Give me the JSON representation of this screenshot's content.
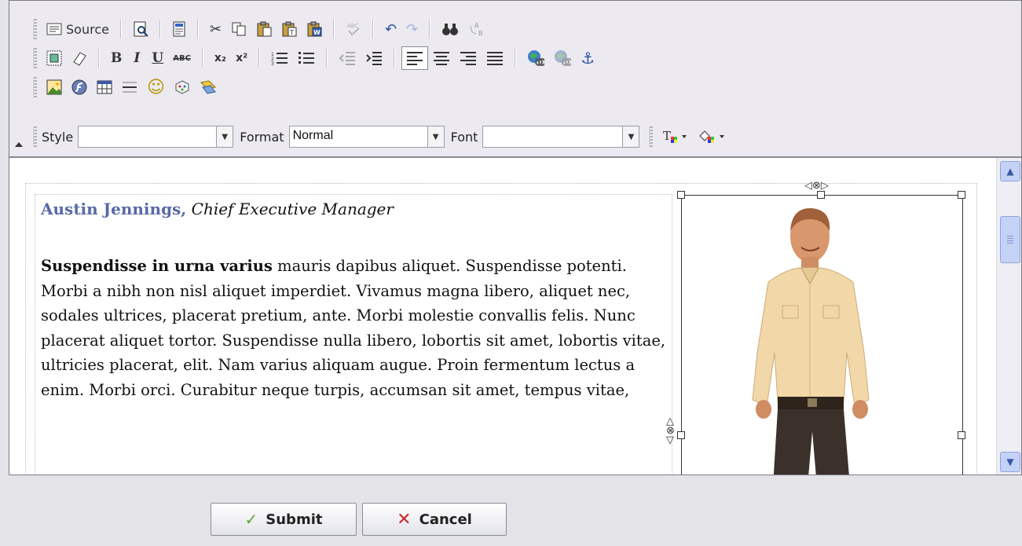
{
  "toolbar": {
    "row1": {
      "source_label": "Source",
      "icons": [
        "source-icon",
        "preview-icon",
        "templates-icon",
        "cut-icon",
        "copy-icon",
        "paste-icon",
        "paste-text-icon",
        "paste-word-icon",
        "spellcheck-icon",
        "undo-icon",
        "redo-icon",
        "find-icon",
        "replace-icon"
      ]
    },
    "row2": {
      "bold": "B",
      "italic": "I",
      "underline": "U",
      "strike": "ABC",
      "subscript": "x₂",
      "superscript": "x²"
    },
    "row4": {
      "style_label": "Style",
      "style_value": "",
      "format_label": "Format",
      "format_value": "Normal",
      "font_label": "Font",
      "font_value": ""
    }
  },
  "content": {
    "author_name": "Austin Jennings,",
    "author_title": "Chief Executive Manager",
    "body_lead": "Suspendisse in urna varius",
    "body_text": "mauris dapibus aliquet. Suspendisse potenti. Morbi a nibh non nisl aliquet imperdiet. Vivamus magna libero, aliquet nec, sodales ultrices, placerat pretium, ante. Morbi molestie convallis felis. Nunc placerat aliquet tortor. Suspendisse nulla libero, lobortis sit amet, lobortis vitae, ultricies placerat, elit. Nam varius aliquam augue. Proin fermentum lectus a enim. Morbi orci. Curabitur neque turpis, accumsan sit amet, tempus vitae,"
  },
  "buttons": {
    "submit_label": "Submit",
    "cancel_label": "Cancel"
  },
  "colors": {
    "author_name": "#5869a7",
    "submit_check": "#58a832",
    "cancel_x": "#cc2a2a"
  }
}
